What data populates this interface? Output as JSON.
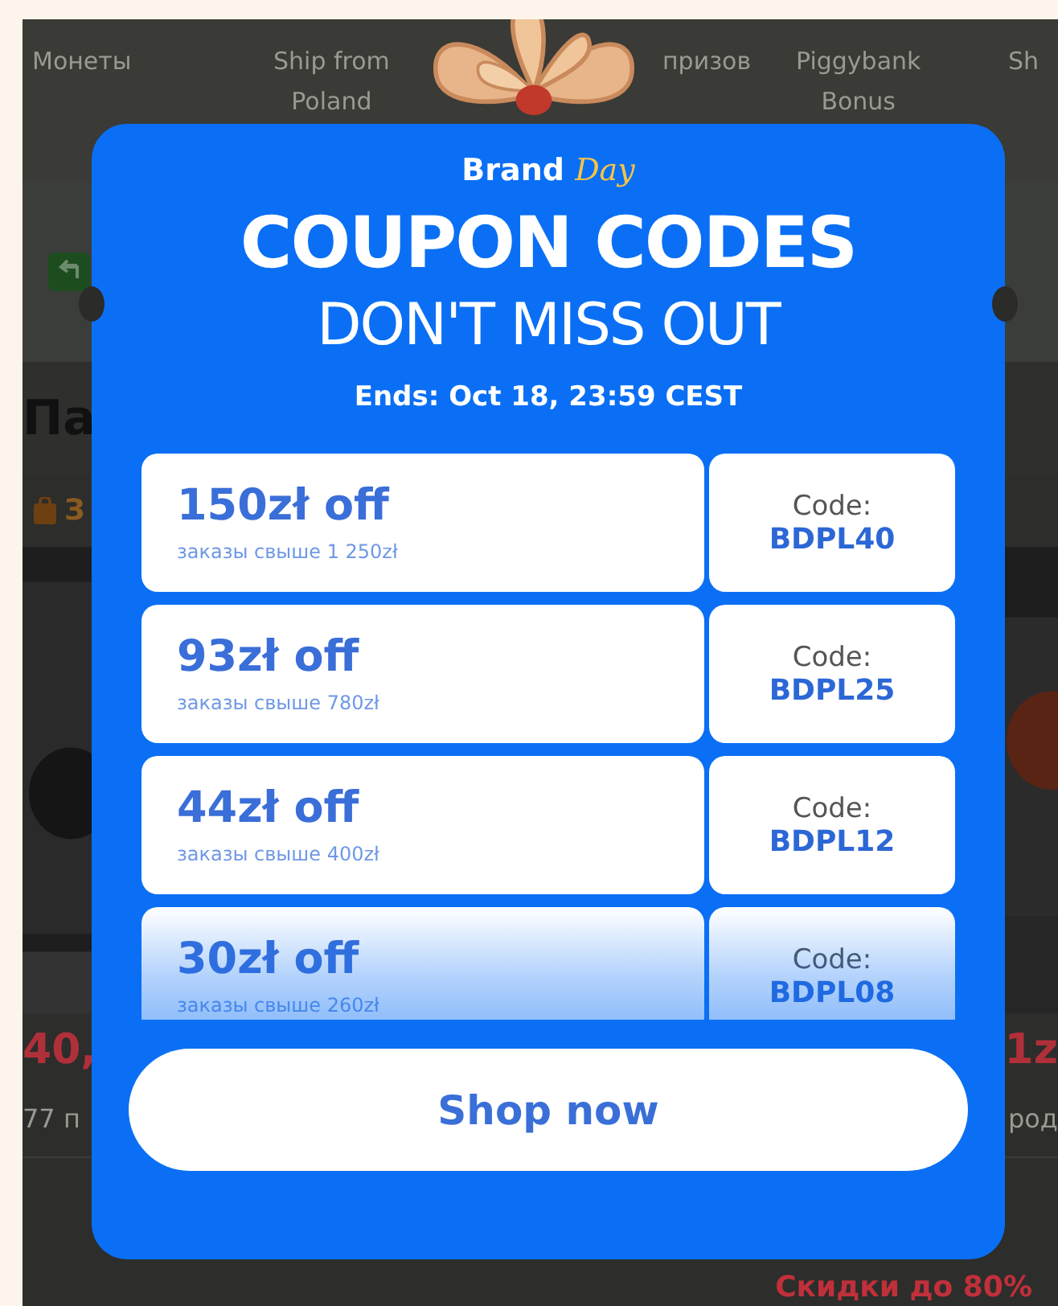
{
  "background_page": {
    "nav": [
      "Монеты",
      "Ship from\nPoland",
      "призов",
      "Piggybank\nBonus",
      "Sh"
    ],
    "title": "Па",
    "badge_text": "З",
    "prices": [
      "40,",
      "1z"
    ],
    "sold": [
      "77 п",
      "род"
    ],
    "promo": "Скидки до 80%"
  },
  "popup": {
    "brand": "Brand",
    "brand_accent": "Day",
    "title": "COUPON CODES",
    "subtitle": "DON'T MISS OUT",
    "ends": "Ends: Oct 18, 23:59 CEST",
    "coupons": [
      {
        "amount": "150zł off",
        "condition": "заказы свыше 1 250zł",
        "code_label": "Code:",
        "code": "BDPL40"
      },
      {
        "amount": "93zł off",
        "condition": "заказы свыше 780zł",
        "code_label": "Code:",
        "code": "BDPL25"
      },
      {
        "amount": "44zł off",
        "condition": "заказы свыше 400zł",
        "code_label": "Code:",
        "code": "BDPL12"
      },
      {
        "amount": "30zł off",
        "condition": "заказы свыше 260zł",
        "code_label": "Code:",
        "code": "BDPL08"
      }
    ],
    "button": "Shop now"
  }
}
